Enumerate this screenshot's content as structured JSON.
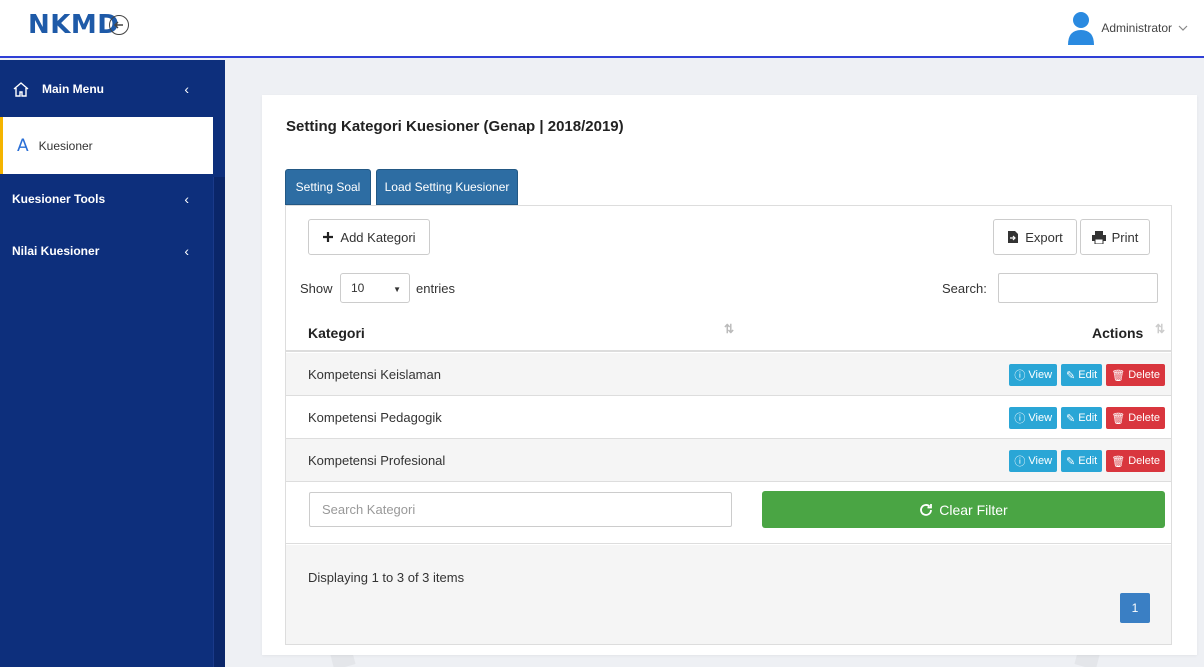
{
  "app": {
    "logo": "NKMD"
  },
  "header": {
    "user_name": "Administrator"
  },
  "sidebar": {
    "items": [
      {
        "label": "Main Menu"
      },
      {
        "label": "Kuesioner",
        "icon": "A"
      },
      {
        "label": "Kuesioner Tools"
      },
      {
        "label": "Nilai Kuesioner"
      }
    ]
  },
  "main": {
    "title": "Setting Kategori Kuesioner (Genap | 2018/2019)",
    "tabs": [
      {
        "label": "Setting Soal"
      },
      {
        "label": "Load Setting Kuesioner"
      }
    ],
    "toolbar": {
      "add_label": "Add Kategori",
      "export_label": "Export",
      "print_label": "Print"
    },
    "length": {
      "show_label": "Show",
      "value": "10",
      "entries_label": "entries"
    },
    "search": {
      "label": "Search:"
    },
    "table": {
      "headers": [
        "Kategori",
        "Actions"
      ],
      "rows": [
        {
          "kategori": "Kompetensi Keislaman"
        },
        {
          "kategori": "Kompetensi Pedagogik"
        },
        {
          "kategori": "Kompetensi Profesional"
        }
      ],
      "actions": {
        "view": "View",
        "edit": "Edit",
        "delete": "Delete"
      }
    },
    "filter": {
      "placeholder": "Search Kategori",
      "clear_label": "Clear Filter"
    },
    "footer": {
      "display_text": "Displaying 1 to 3 of 3 items",
      "page": "1"
    }
  },
  "colors": {
    "sidebar": "#0d2f7c",
    "tab": "#2d6da3",
    "info_button": "#2aa6d6",
    "danger_button": "#d9363e",
    "success_button": "#4aa544",
    "pagination": "#3a7fc4"
  }
}
